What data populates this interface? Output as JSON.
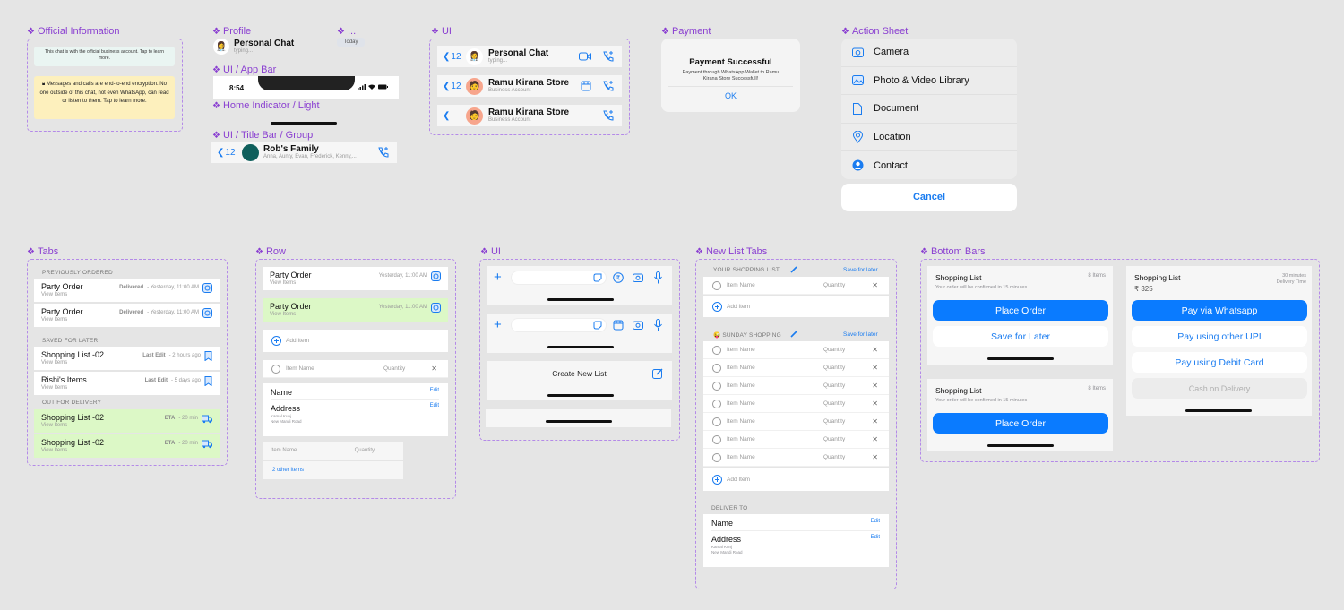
{
  "sections": {
    "official": "Official Information",
    "profile": "Profile",
    "date": "...",
    "app_bar": "UI / App Bar",
    "home_indicator": "Home Indicator / Light",
    "title_bar_group": "UI / Title Bar / Group",
    "ui_title_bars": "UI",
    "payment": "Payment",
    "action_sheet": "Action Sheet",
    "tabs": "Tabs",
    "row": "Row",
    "ui_inputs": "UI",
    "new_list_tabs": "New List Tabs",
    "bottom_bars": "Bottom Bars"
  },
  "official": {
    "business_notice": "This chat is with the official business account. Tap to learn more.",
    "encryption_notice": "Messages and calls are end-to-end encryption. No one outside of this chat, not even WhatsApp, can read or listen to them. Tap to learn more."
  },
  "profile": {
    "name": "Personal Chat",
    "status": "typing..."
  },
  "date_chip": "Today",
  "app_bar": {
    "time": "8:54"
  },
  "group_title": {
    "back_count": "12",
    "name": "Rob's Family",
    "members": "Anna, Aunty, Evan, Frederick, Kenny,..."
  },
  "title_bars": [
    {
      "back_count": "12",
      "name": "Personal Chat",
      "sub": "typing..."
    },
    {
      "back_count": "12",
      "name": "Ramu Kirana Store",
      "sub": "Business Account"
    },
    {
      "back_count": "",
      "name": "Ramu Kirana Store",
      "sub": "Business Account"
    }
  ],
  "payment": {
    "title": "Payment Successful",
    "message": "Payment through WhatsApp Wallet to Ramu Kirana Store Successfull!",
    "ok": "OK"
  },
  "action_sheet": {
    "items": [
      "Camera",
      "Photo & Video Library",
      "Document",
      "Location",
      "Contact"
    ],
    "cancel": "Cancel"
  },
  "tabs": {
    "previously_ordered": "PREVIOUSLY ORDERED",
    "saved_for_later": "SAVED FOR LATER",
    "out_for_delivery": "OUT FOR DELIVERY",
    "view_items": "View Items",
    "rows": [
      {
        "title": "Party Order",
        "status": "Delivered",
        "time": "- Yesterday, 11:00 AM"
      },
      {
        "title": "Party Order",
        "status": "Delivered",
        "time": "- Yesterday, 11:00 AM"
      },
      {
        "title": "Shopping List -02",
        "status": "Last Edit",
        "time": "- 2 hours ago"
      },
      {
        "title": "Rishi's Items",
        "status": "Last Edit",
        "time": "- 5 days ago"
      },
      {
        "title": "Shopping List -02",
        "status": "ETA",
        "time": "- 20 min"
      },
      {
        "title": "Shopping List -02",
        "status": "ETA",
        "time": "- 20 min"
      }
    ]
  },
  "row": {
    "order_title": "Party Order",
    "order_time": "Yesterday, 11:00 AM",
    "view_items": "View Items",
    "add_item": "Add Item",
    "item_name": "Item Name",
    "quantity": "Quantity",
    "name_label": "Name",
    "address_label": "Address",
    "edit": "Edit",
    "address_line1": "Kamal Kunj",
    "address_line2": "New Mandi Road",
    "other_items": "2 other Items"
  },
  "ui_inputs": {
    "create_new_list": "Create New List"
  },
  "new_list": {
    "your_list": "YOUR SHOPPING LIST",
    "sunday": "SUNDAY SHOPPING",
    "sunday_emoji": "😜",
    "save_for_later": "Save for later",
    "item_name": "Item Name",
    "quantity": "Quantity",
    "add_item": "Add Item",
    "deliver_to": "DELIVER TO",
    "name_label": "Name",
    "address_label": "Address",
    "edit": "Edit",
    "address_line1": "Kamal Kunj",
    "address_line2": "New Mandi Road"
  },
  "bottom_bars": {
    "title": "Shopping List",
    "count": "8 Items",
    "confirm": "Your order will be confirmed in 15 minutes",
    "place_order": "Place Order",
    "save_later": "Save for Later",
    "price": "₹ 325",
    "delivery_minutes": "30 minutes",
    "delivery_time": "Delivery Time",
    "pay_whatsapp": "Pay via Whatsapp",
    "pay_upi": "Pay using other UPI",
    "pay_debit": "Pay using Debit Card",
    "cod": "Cash on Delivery"
  },
  "colors": {
    "accent": "#0a7bff",
    "label": "#8a3fd1",
    "green_row": "#dcf8c6",
    "notice_yellow": "#fdf0bd"
  }
}
